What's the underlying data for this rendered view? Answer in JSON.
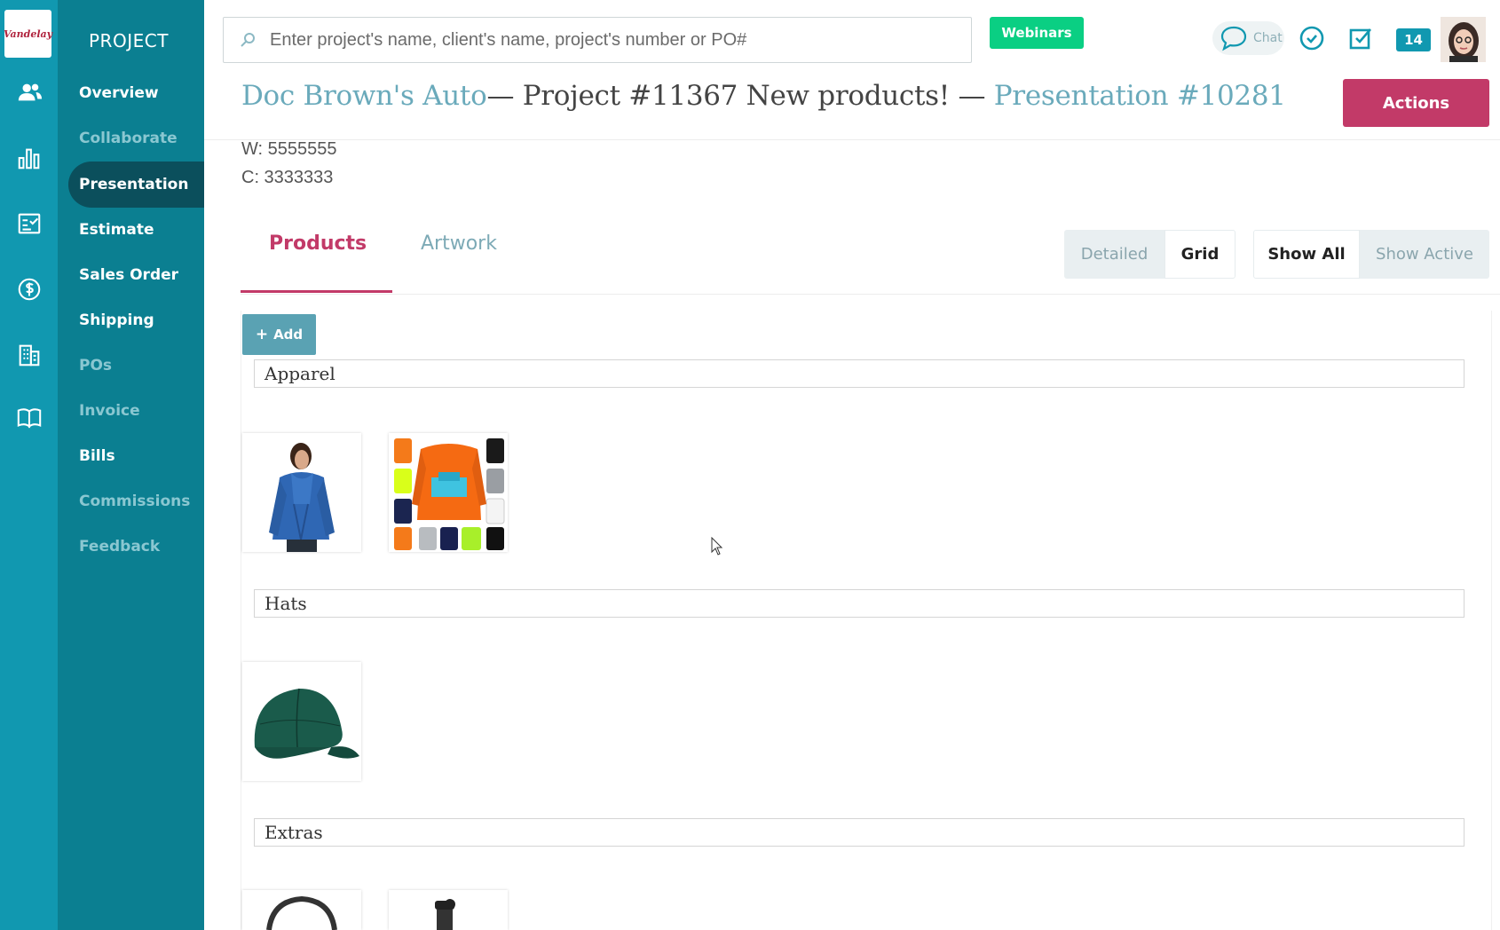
{
  "brand": {
    "logo_text": "Vandelay",
    "accent": "#1198b0",
    "nav_bg": "#0b7f91",
    "action_color": "#c23a68"
  },
  "nav": {
    "section_title": "PROJECT",
    "items": [
      {
        "label": "Overview",
        "state": "enabled"
      },
      {
        "label": "Collaborate",
        "state": "muted"
      },
      {
        "label": "Presentation",
        "state": "active"
      },
      {
        "label": "Estimate",
        "state": "enabled"
      },
      {
        "label": "Sales Order",
        "state": "enabled"
      },
      {
        "label": "Shipping",
        "state": "enabled"
      },
      {
        "label": "POs",
        "state": "muted"
      },
      {
        "label": "Invoice",
        "state": "muted"
      },
      {
        "label": "Bills",
        "state": "enabled"
      },
      {
        "label": "Commissions",
        "state": "muted"
      },
      {
        "label": "Feedback",
        "state": "muted"
      }
    ]
  },
  "rail_icons": [
    "users-icon",
    "bar-chart-icon",
    "checklist-icon",
    "dollar-icon",
    "building-icon",
    "book-icon"
  ],
  "header": {
    "search_placeholder": "Enter project's name, client's name, project's number or PO#",
    "webinars_label": "Webinars",
    "chat_label": "Chat",
    "notification_count": "14"
  },
  "title": {
    "client": "Doc Brown's Auto",
    "project": "— Project #11367 New products! —",
    "presentation": "Presentation #10281"
  },
  "actions_label": "Actions",
  "contact": {
    "work": "W: 5555555",
    "cell": "C: 3333333"
  },
  "tabs": {
    "products": "Products",
    "artwork": "Artwork",
    "active": "Products"
  },
  "view_toggle": {
    "detailed": "Detailed",
    "grid": "Grid",
    "selected": "Grid"
  },
  "filter_toggle": {
    "show_all": "Show All",
    "show_active": "Show Active",
    "selected": "Show All"
  },
  "add_label": "Add",
  "sections": [
    {
      "title": "Apparel",
      "products": [
        "blue-wrap-sweater",
        "multicolor-long-sleeve-tees"
      ]
    },
    {
      "title": "Hats",
      "products": [
        "green-baseball-cap"
      ]
    },
    {
      "title": "Extras",
      "products": [
        "steering-wheel-cover",
        "black-bottle"
      ]
    }
  ]
}
